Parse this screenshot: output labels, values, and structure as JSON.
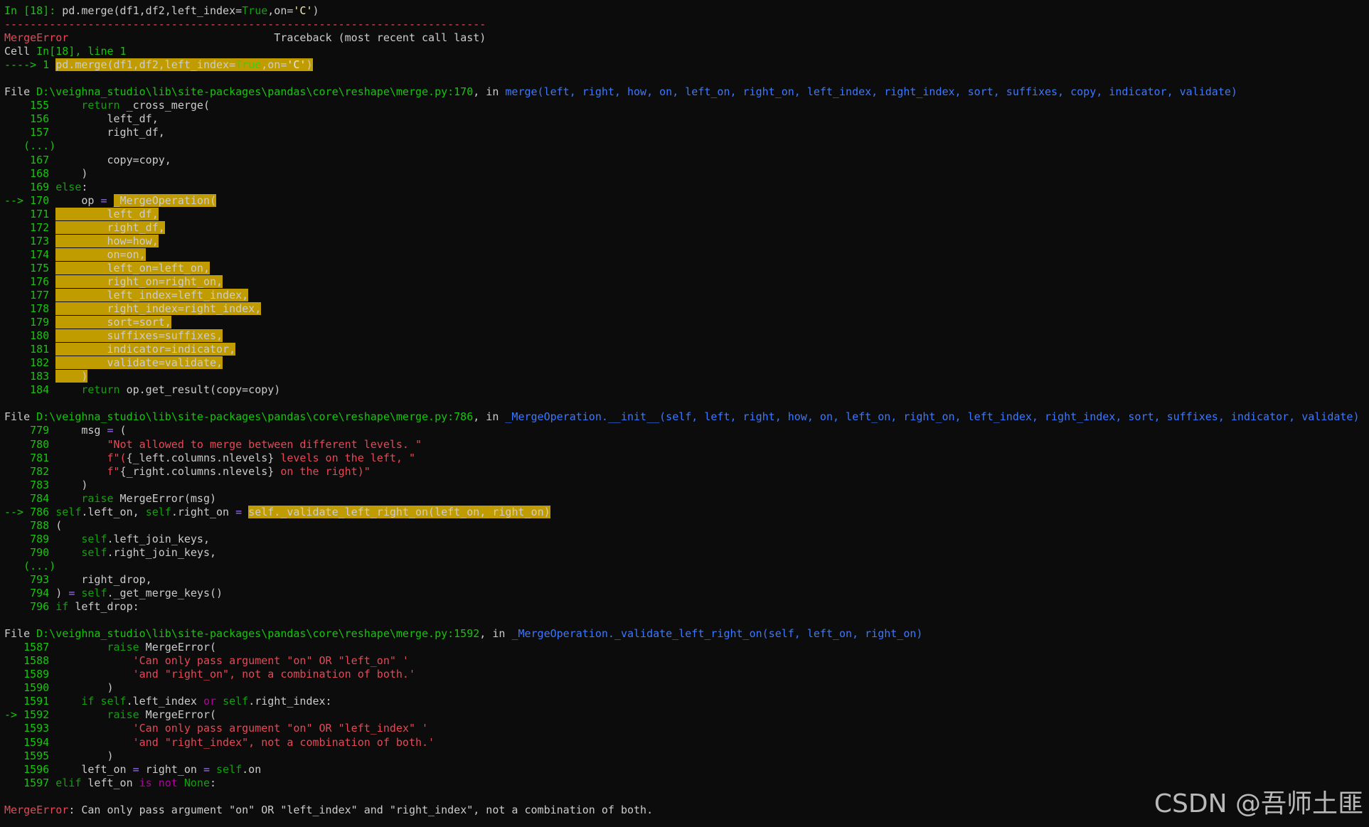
{
  "colors": {
    "background": "#0c0c0c",
    "text": "#cccccc",
    "error_red": "#e74856",
    "prompt_green": "#16c60c",
    "path_blue": "#3b78ff",
    "highlight_bg": "#c19c00",
    "keyword_magenta": "#b4009e"
  },
  "watermark": "CSDN @吾师土匪",
  "lines": [
    [
      [
        "In [18]: ",
        "green"
      ],
      [
        "pd.merge(df1,df2,left_index=",
        "txt"
      ],
      [
        "True",
        "dgreen"
      ],
      [
        ",on=",
        "txt"
      ],
      [
        "'C'",
        "yel"
      ],
      [
        ")",
        "txt"
      ]
    ],
    [
      [
        "---------------------------------------------------------------------------",
        "red"
      ]
    ],
    [
      [
        "MergeError",
        "red"
      ],
      [
        "                                Traceback (most recent call last)",
        "txt"
      ]
    ],
    [
      [
        "Cell ",
        "txt"
      ],
      [
        "In[18], line 1",
        "green"
      ]
    ],
    [
      [
        "----> 1 ",
        "green"
      ],
      [
        "pd.merge(df1,df2,left_index=",
        "hl"
      ],
      [
        "True",
        "hlg"
      ],
      [
        ",on=",
        "hl"
      ],
      [
        "'C'",
        "hlk"
      ],
      [
        ")",
        "hl"
      ]
    ],
    [
      [
        "",
        "txt"
      ]
    ],
    [
      [
        "File ",
        "txt"
      ],
      [
        "D:\\veighna_studio\\lib\\site-packages\\pandas\\core\\reshape\\merge.py:170",
        "green"
      ],
      [
        ", in ",
        "txt"
      ],
      [
        "merge(left, right, how, on, left_on, right_on, left_index, right_index, sort, suffixes, copy, indicator, validate)",
        "blue"
      ]
    ],
    [
      [
        "    155 ",
        "green"
      ],
      [
        "    ",
        "txt"
      ],
      [
        "return",
        "dgreen"
      ],
      [
        " _cross_merge(",
        "txt"
      ]
    ],
    [
      [
        "    156 ",
        "green"
      ],
      [
        "        left_df,",
        "txt"
      ]
    ],
    [
      [
        "    157 ",
        "green"
      ],
      [
        "        right_df,",
        "txt"
      ]
    ],
    [
      [
        "   (...)",
        "green"
      ]
    ],
    [
      [
        "    167 ",
        "green"
      ],
      [
        "        copy=copy,",
        "txt"
      ]
    ],
    [
      [
        "    168 ",
        "green"
      ],
      [
        "    )",
        "txt"
      ]
    ],
    [
      [
        "    169 ",
        "green"
      ],
      [
        "else",
        "dgreen"
      ],
      [
        ":",
        "txt"
      ]
    ],
    [
      [
        "--> 170 ",
        "green"
      ],
      [
        "    op ",
        "txt"
      ],
      [
        "=",
        "pur"
      ],
      [
        " ",
        "txt"
      ],
      [
        "_MergeOperation(",
        "hl"
      ]
    ],
    [
      [
        "    171 ",
        "green"
      ],
      [
        "        left_df,",
        "hl"
      ]
    ],
    [
      [
        "    172 ",
        "green"
      ],
      [
        "        right_df,",
        "hl"
      ]
    ],
    [
      [
        "    173 ",
        "green"
      ],
      [
        "        how=how,",
        "hl"
      ]
    ],
    [
      [
        "    174 ",
        "green"
      ],
      [
        "        on=on,",
        "hl"
      ]
    ],
    [
      [
        "    175 ",
        "green"
      ],
      [
        "        left_on=left_on,",
        "hl"
      ]
    ],
    [
      [
        "    176 ",
        "green"
      ],
      [
        "        right_on=right_on,",
        "hl"
      ]
    ],
    [
      [
        "    177 ",
        "green"
      ],
      [
        "        left_index=left_index,",
        "hl"
      ]
    ],
    [
      [
        "    178 ",
        "green"
      ],
      [
        "        right_index=right_index,",
        "hl"
      ]
    ],
    [
      [
        "    179 ",
        "green"
      ],
      [
        "        sort=sort,",
        "hl"
      ]
    ],
    [
      [
        "    180 ",
        "green"
      ],
      [
        "        suffixes=suffixes,",
        "hl"
      ]
    ],
    [
      [
        "    181 ",
        "green"
      ],
      [
        "        indicator=indicator,",
        "hl"
      ]
    ],
    [
      [
        "    182 ",
        "green"
      ],
      [
        "        validate=validate,",
        "hl"
      ]
    ],
    [
      [
        "    183 ",
        "green"
      ],
      [
        "    )",
        "hl"
      ]
    ],
    [
      [
        "    184 ",
        "green"
      ],
      [
        "    ",
        "txt"
      ],
      [
        "return",
        "dgreen"
      ],
      [
        " op.get_result(copy=copy)",
        "txt"
      ]
    ],
    [
      [
        "",
        "txt"
      ]
    ],
    [
      [
        "File ",
        "txt"
      ],
      [
        "D:\\veighna_studio\\lib\\site-packages\\pandas\\core\\reshape\\merge.py:786",
        "green"
      ],
      [
        ", in ",
        "txt"
      ],
      [
        "_MergeOperation.__init__(self, left, right, how, on, left_on, right_on, left_index, right_index, sort, suffixes, indicator, validate)",
        "blue"
      ]
    ],
    [
      [
        "    779 ",
        "green"
      ],
      [
        "    msg ",
        "txt"
      ],
      [
        "=",
        "pur"
      ],
      [
        " (",
        "txt"
      ]
    ],
    [
      [
        "    780 ",
        "green"
      ],
      [
        "        ",
        "txt"
      ],
      [
        "\"Not allowed to merge between different levels. \"",
        "red"
      ]
    ],
    [
      [
        "    781 ",
        "green"
      ],
      [
        "        ",
        "txt"
      ],
      [
        "f\"(",
        "red"
      ],
      [
        "{_left.columns.nlevels}",
        "txt"
      ],
      [
        " levels on the left, \"",
        "red"
      ]
    ],
    [
      [
        "    782 ",
        "green"
      ],
      [
        "        ",
        "txt"
      ],
      [
        "f\"",
        "red"
      ],
      [
        "{_right.columns.nlevels}",
        "txt"
      ],
      [
        " on the right)\"",
        "red"
      ]
    ],
    [
      [
        "    783 ",
        "green"
      ],
      [
        "    )",
        "txt"
      ]
    ],
    [
      [
        "    784 ",
        "green"
      ],
      [
        "    ",
        "txt"
      ],
      [
        "raise",
        "dgreen"
      ],
      [
        " MergeError(msg)",
        "txt"
      ]
    ],
    [
      [
        "--> 786 ",
        "green"
      ],
      [
        "self",
        "dgreen"
      ],
      [
        ".left_on, ",
        "txt"
      ],
      [
        "self",
        "dgreen"
      ],
      [
        ".right_on ",
        "txt"
      ],
      [
        "=",
        "pur"
      ],
      [
        " ",
        "txt"
      ],
      [
        "self._validate_left_right_on(left_on, right_on)",
        "hl"
      ]
    ],
    [
      [
        "    788 ",
        "green"
      ],
      [
        "(",
        "txt"
      ]
    ],
    [
      [
        "    789 ",
        "green"
      ],
      [
        "    ",
        "txt"
      ],
      [
        "self",
        "dgreen"
      ],
      [
        ".left_join_keys,",
        "txt"
      ]
    ],
    [
      [
        "    790 ",
        "green"
      ],
      [
        "    ",
        "txt"
      ],
      [
        "self",
        "dgreen"
      ],
      [
        ".right_join_keys,",
        "txt"
      ]
    ],
    [
      [
        "   (...)",
        "green"
      ]
    ],
    [
      [
        "    793 ",
        "green"
      ],
      [
        "    right_drop,",
        "txt"
      ]
    ],
    [
      [
        "    794 ",
        "green"
      ],
      [
        ") ",
        "txt"
      ],
      [
        "=",
        "pur"
      ],
      [
        " ",
        "txt"
      ],
      [
        "self",
        "dgreen"
      ],
      [
        "._get_merge_keys()",
        "txt"
      ]
    ],
    [
      [
        "    796 ",
        "green"
      ],
      [
        "if",
        "dgreen"
      ],
      [
        " left_drop:",
        "txt"
      ]
    ],
    [
      [
        "",
        "txt"
      ]
    ],
    [
      [
        "File ",
        "txt"
      ],
      [
        "D:\\veighna_studio\\lib\\site-packages\\pandas\\core\\reshape\\merge.py:1592",
        "green"
      ],
      [
        ", in ",
        "txt"
      ],
      [
        "_MergeOperation._validate_left_right_on(self, left_on, right_on)",
        "blue"
      ]
    ],
    [
      [
        "   1587 ",
        "green"
      ],
      [
        "        ",
        "txt"
      ],
      [
        "raise",
        "dgreen"
      ],
      [
        " MergeError(",
        "txt"
      ]
    ],
    [
      [
        "   1588 ",
        "green"
      ],
      [
        "            ",
        "txt"
      ],
      [
        "'Can only pass argument \"on\" OR \"left_on\" '",
        "red"
      ]
    ],
    [
      [
        "   1589 ",
        "green"
      ],
      [
        "            ",
        "txt"
      ],
      [
        "'and \"right_on\", not a combination of both.'",
        "red"
      ]
    ],
    [
      [
        "   1590 ",
        "green"
      ],
      [
        "        )",
        "txt"
      ]
    ],
    [
      [
        "   1591 ",
        "green"
      ],
      [
        "    ",
        "txt"
      ],
      [
        "if",
        "dgreen"
      ],
      [
        " ",
        "txt"
      ],
      [
        "self",
        "dgreen"
      ],
      [
        ".left_index ",
        "txt"
      ],
      [
        "or",
        "mag"
      ],
      [
        " ",
        "txt"
      ],
      [
        "self",
        "dgreen"
      ],
      [
        ".right_index:",
        "txt"
      ]
    ],
    [
      [
        "-> 1592 ",
        "green"
      ],
      [
        "        ",
        "txt"
      ],
      [
        "raise",
        "dgreen"
      ],
      [
        " MergeError(",
        "txt"
      ]
    ],
    [
      [
        "   1593 ",
        "green"
      ],
      [
        "            ",
        "txt"
      ],
      [
        "'Can only pass argument \"on\" OR \"left_index\" '",
        "red"
      ]
    ],
    [
      [
        "   1594 ",
        "green"
      ],
      [
        "            ",
        "txt"
      ],
      [
        "'and \"right_index\", not a combination of both.'",
        "red"
      ]
    ],
    [
      [
        "   1595 ",
        "green"
      ],
      [
        "        )",
        "txt"
      ]
    ],
    [
      [
        "   1596 ",
        "green"
      ],
      [
        "    left_on ",
        "txt"
      ],
      [
        "=",
        "pur"
      ],
      [
        " right_on ",
        "txt"
      ],
      [
        "=",
        "pur"
      ],
      [
        " ",
        "txt"
      ],
      [
        "self",
        "dgreen"
      ],
      [
        ".on",
        "txt"
      ]
    ],
    [
      [
        "   1597 ",
        "green"
      ],
      [
        "elif",
        "dgreen"
      ],
      [
        " left_on ",
        "txt"
      ],
      [
        "is",
        "mag"
      ],
      [
        " ",
        "txt"
      ],
      [
        "not",
        "mag"
      ],
      [
        " ",
        "txt"
      ],
      [
        "None",
        "dgreen"
      ],
      [
        ":",
        "txt"
      ]
    ],
    [
      [
        "",
        "txt"
      ]
    ],
    [
      [
        "MergeError",
        "red"
      ],
      [
        ": Can only pass argument \"on\" OR \"left_index\" and \"right_index\", not a combination of both.",
        "txt"
      ]
    ]
  ]
}
